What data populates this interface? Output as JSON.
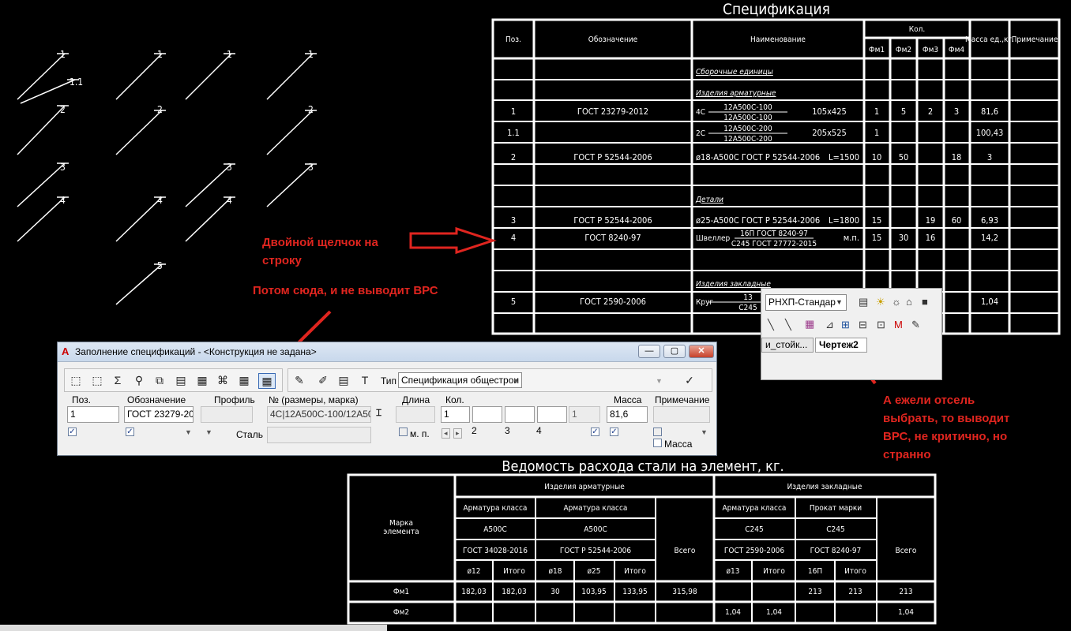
{
  "drawing": {
    "leaders": [
      {
        "text": "1"
      },
      {
        "text": "1.1"
      },
      {
        "text": "2"
      },
      {
        "text": "3"
      },
      {
        "text": "4"
      },
      {
        "text": "1"
      },
      {
        "text": "2"
      },
      {
        "text": "4"
      },
      {
        "text": "5"
      },
      {
        "text": "1"
      },
      {
        "text": "3"
      },
      {
        "text": "4"
      },
      {
        "text": "1"
      },
      {
        "text": "2"
      },
      {
        "text": "3"
      }
    ]
  },
  "spec": {
    "title": "Спецификация",
    "headers": {
      "pos": "Поз.",
      "designation": "Обозначение",
      "name": "Наименование",
      "qty": "Кол.",
      "fm1": "Фм1",
      "fm2": "Фм2",
      "fm3": "Фм3",
      "fm4": "Фм4",
      "mass": "Масса ед.,кг.",
      "note": "Примечание"
    },
    "sections": {
      "assembly": "Сборочные единицы",
      "rebar": "Изделия арматурные",
      "details": "Детали",
      "embedded": "Изделия закладные"
    },
    "rows": [
      {
        "pos": "1",
        "des": "ГОСТ 23279-2012",
        "n1": "4С",
        "frac_top": "12А500С-100",
        "frac_bot": "12А500С-100",
        "n2": "105х425",
        "fm1": "1",
        "fm2": "5",
        "fm3": "2",
        "fm4": "3",
        "mass": "81,6"
      },
      {
        "pos": "1.1",
        "des": "",
        "n1": "2С",
        "frac_top": "12А500С-200",
        "frac_bot": "12А500С-200",
        "n2": "205х525",
        "fm1": "1",
        "fm2": "",
        "fm3": "",
        "fm4": "",
        "mass": "100,43"
      },
      {
        "pos": "2",
        "des": "ГОСТ Р 52544-2006",
        "name": "ø18-А500С ГОСТ Р 52544-2006",
        "len": "L=1500",
        "fm1": "10",
        "fm2": "50",
        "fm3": "",
        "fm4": "18",
        "mass": "3"
      },
      {
        "pos": "3",
        "des": "ГОСТ Р 52544-2006",
        "name": "ø25-А500С ГОСТ Р 52544-2006",
        "len": "L=1800",
        "fm1": "15",
        "fm2": "",
        "fm3": "19",
        "fm4": "60",
        "mass": "6,93"
      },
      {
        "pos": "4",
        "des": "ГОСТ 8240-97",
        "n1": "Швеллер",
        "frac_top": "16П ГОСТ 8240-97",
        "frac_bot": "С245 ГОСТ 27772-2015",
        "n2": "м.п.",
        "fm1": "15",
        "fm2": "30",
        "fm3": "16",
        "fm4": "",
        "mass": "14,2"
      },
      {
        "pos": "5",
        "des": "ГОСТ 2590-2006",
        "n1": "Круг",
        "frac_top": "13",
        "frac_bot": "С245",
        "n2": "",
        "fm1": "",
        "fm2": "",
        "fm3": "",
        "fm4": "",
        "mass": "1,04"
      }
    ]
  },
  "vrs": {
    "title": "Ведомость расхода стали на элемент, кг.",
    "mark": "Марка элемента",
    "group1": "Изделия арматурные",
    "group2": "Изделия закладные",
    "cls1": "Арматура класса",
    "cls2": "Арматура класса",
    "cls3": "Арматура класса",
    "cls4": "Прокат марки",
    "st1": "А500С",
    "st2": "А500С",
    "st3": "С245",
    "st4": "С245",
    "g1": "ГОСТ 34028-2016",
    "g2": "ГОСТ Р 52544-2006",
    "g3": "ГОСТ 2590-2006",
    "g4": "ГОСТ 8240-97",
    "total1": "Всего",
    "total2": "Всего",
    "sub": [
      "ø12",
      "Итого",
      "ø18",
      "ø25",
      "Итого",
      "ø13",
      "Итого",
      "16П",
      "Итого"
    ],
    "rows": [
      {
        "mark": "Фм1",
        "vals": [
          "182,03",
          "182,03",
          "30",
          "103,95",
          "133,95",
          "315,98",
          "",
          "",
          "213",
          "213",
          "213"
        ]
      },
      {
        "mark": "Фм2",
        "vals": [
          "",
          "",
          "",
          "",
          "",
          "",
          "1,04",
          "1,04",
          "",
          "",
          "1,04"
        ]
      }
    ]
  },
  "annotations": {
    "a1": "Двойной щелчок на строку",
    "a2": "Потом сюда, и не выводит ВРС",
    "a3": "А ежели отсель выбрать, то выводит ВРС, не критично, но странно"
  },
  "dialog": {
    "title": "Заполнение спецификаций - <Конструкция не задана>",
    "type_label": "Тип",
    "type_value": "Спецификация общестрои",
    "labels": {
      "pos": "Поз.",
      "des": "Обозначение",
      "profile": "Профиль",
      "num": "№ (размеры, марка)",
      "len": "Длина",
      "qty": "Кол.",
      "mass": "Масса",
      "note": "Примечание",
      "steel": "Сталь",
      "mp": "м. п.",
      "mass_cb": "Масса"
    },
    "values": {
      "pos": "1",
      "des": "ГОСТ 23279-2012",
      "num": "4С|12А500С-100/12А500С",
      "qty1": "1",
      "qty_total": "1",
      "mass": "81,6"
    },
    "qty_nums": [
      "2",
      "3",
      "4"
    ]
  },
  "layer_bar": {
    "layer": "РНХП-Стандар",
    "tab1": "и_стойк...",
    "tab2": "Чертеж2"
  },
  "colors": {
    "accent_red": "#e0251f",
    "white": "#ffffff",
    "bg": "#000000"
  }
}
